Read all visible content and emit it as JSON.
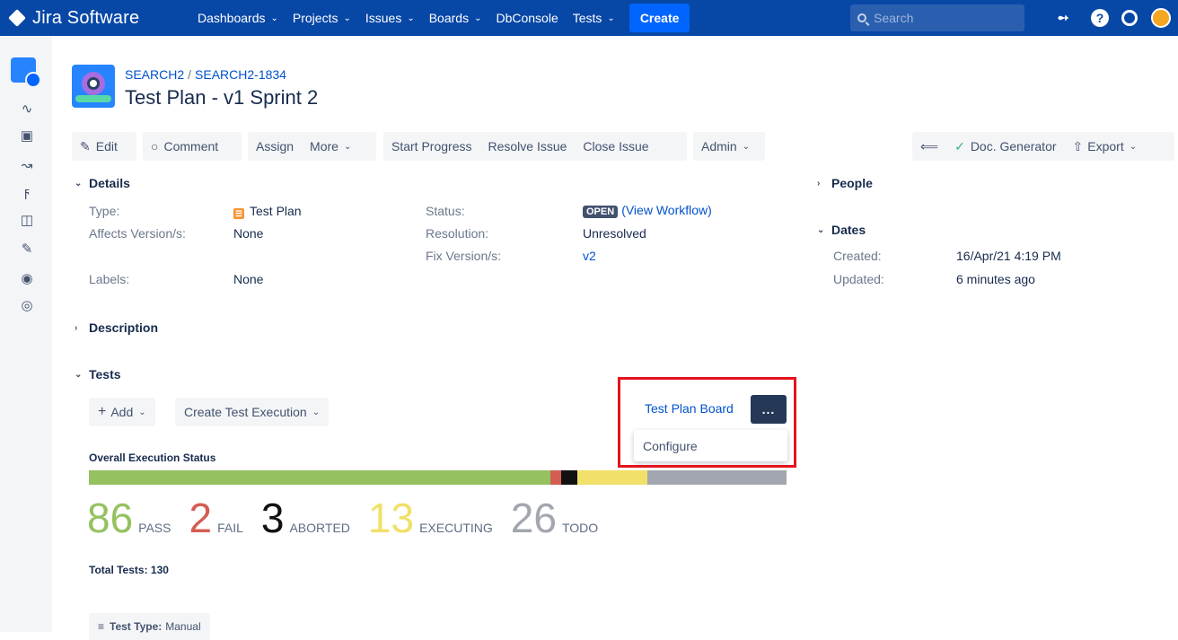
{
  "nav": {
    "brand": "Jira Software",
    "items": [
      "Dashboards",
      "Projects",
      "Issues",
      "Boards",
      "DbConsole",
      "Tests"
    ],
    "items_with_chevron": [
      true,
      true,
      true,
      true,
      false,
      true
    ],
    "create": "Create",
    "search_placeholder": "Search"
  },
  "issue": {
    "project_key": "SEARCH2",
    "issue_key": "SEARCH2-1834",
    "title": "Test Plan - v1 Sprint 2"
  },
  "toolbar": {
    "edit": "Edit",
    "comment": "Comment",
    "assign": "Assign",
    "more": "More",
    "start_progress": "Start Progress",
    "resolve_issue": "Resolve Issue",
    "close_issue": "Close Issue",
    "admin": "Admin",
    "doc_generator": "Doc. Generator",
    "export": "Export"
  },
  "details": {
    "heading": "Details",
    "type_label": "Type:",
    "type_value": "Test Plan",
    "affects_label": "Affects Version/s:",
    "affects_value": "None",
    "labels_label": "Labels:",
    "labels_value": "None",
    "status_label": "Status:",
    "status_value": "OPEN",
    "view_workflow": "(View Workflow)",
    "resolution_label": "Resolution:",
    "resolution_value": "Unresolved",
    "fix_label": "Fix Version/s:",
    "fix_value": "v2"
  },
  "people": {
    "heading": "People"
  },
  "dates": {
    "heading": "Dates",
    "created_label": "Created:",
    "created_value": "16/Apr/21 4:19 PM",
    "updated_label": "Updated:",
    "updated_value": "6 minutes ago"
  },
  "description": {
    "heading": "Description"
  },
  "tests": {
    "heading": "Tests",
    "add": "Add",
    "create_execution": "Create Test Execution",
    "board_link": "Test Plan Board",
    "dots": "...",
    "configure": "Configure",
    "overall_label": "Overall Execution Status",
    "total_label": "Total Tests: 130",
    "test_type_label": "Test Type:",
    "test_type_value": "Manual",
    "statuses": [
      {
        "count": "86",
        "label": "PASS",
        "color": "#95c160",
        "value": 86
      },
      {
        "count": "2",
        "label": "FAIL",
        "color": "#d45d52",
        "value": 2
      },
      {
        "count": "3",
        "label": "ABORTED",
        "color": "#111111",
        "value": 3
      },
      {
        "count": "13",
        "label": "EXECUTING",
        "color": "#f1e069",
        "value": 13
      },
      {
        "count": "26",
        "label": "TODO",
        "color": "#a2a6ae",
        "value": 26
      }
    ]
  }
}
